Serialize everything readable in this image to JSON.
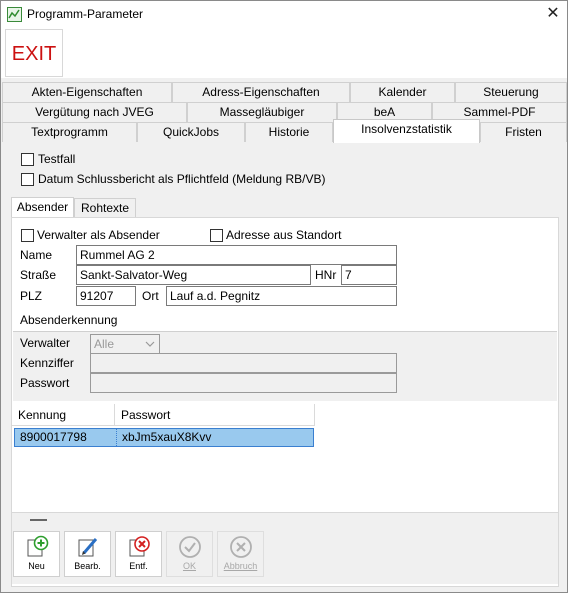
{
  "window": {
    "title": "Programm-Parameter",
    "close_glyph": "✕"
  },
  "toolbar": {
    "exit_label": "EXIT"
  },
  "tabs": {
    "row1": [
      "Akten-Eigenschaften",
      "Adress-Eigenschaften",
      "Kalender",
      "Steuerung"
    ],
    "row2": [
      "Vergütung nach JVEG",
      "Massegläubiger",
      "beA",
      "Sammel-PDF"
    ],
    "row3": [
      "Textprogramm",
      "QuickJobs",
      "Historie",
      "Insolvenzstatistik",
      "Fristen"
    ],
    "active": "Insolvenzstatistik"
  },
  "options": {
    "testfall": "Testfall",
    "schlussbericht": "Datum Schlussbericht als Pflichtfeld (Meldung RB/VB)"
  },
  "subtabs": [
    "Absender",
    "Rohtexte"
  ],
  "absender": {
    "verwalter_als_absender": "Verwalter als Absender",
    "adresse_aus_standort": "Adresse aus Standort",
    "name_label": "Name",
    "name_value": "Rummel AG 2",
    "strasse_label": "Straße",
    "strasse_value": "Sankt-Salvator-Weg",
    "hnr_label": "HNr",
    "hnr_value": "7",
    "plz_label": "PLZ",
    "plz_value": "91207",
    "ort_label": "Ort",
    "ort_value": "Lauf a.d. Pegnitz"
  },
  "kennung": {
    "section_title": "Absenderkennung",
    "verwalter_label": "Verwalter",
    "verwalter_value": "Alle",
    "kennziffer_label": "Kennziffer",
    "passwort_label": "Passwort"
  },
  "grid": {
    "columns": [
      "Kennung",
      "Passwort"
    ],
    "rows": [
      {
        "kennung": "8900017798",
        "passwort": "xbJm5xauX8Kvv"
      }
    ]
  },
  "actions": {
    "neu": "Neu",
    "bearb": "Bearb.",
    "entf": "Entf.",
    "ok": "OK",
    "abbruch": "Abbruch"
  },
  "colors": {
    "exit_red": "#cc1111",
    "selection": "#99c9ee",
    "add_green": "#2e9e2e",
    "delete_red": "#d42020",
    "edit_blue": "#2a6fc4"
  }
}
